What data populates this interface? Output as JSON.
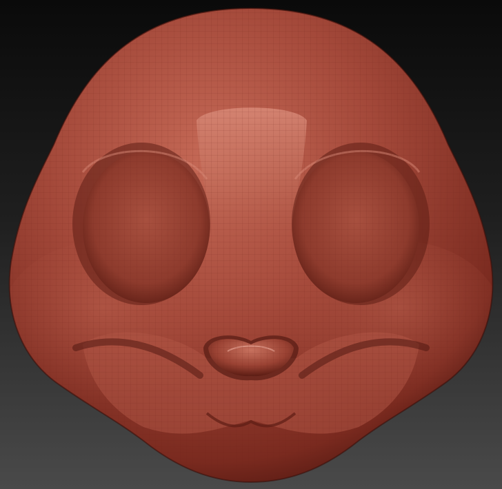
{
  "scene": {
    "subject": "sculpted-head-model",
    "colors": {
      "background_top": "#0a0a0a",
      "background_bottom": "#4a4a4a",
      "clay_base": "#a4493a",
      "clay_highlight": "#d98a78",
      "clay_shadow": "#4a140e",
      "wire_lines": "#6e2418"
    }
  }
}
